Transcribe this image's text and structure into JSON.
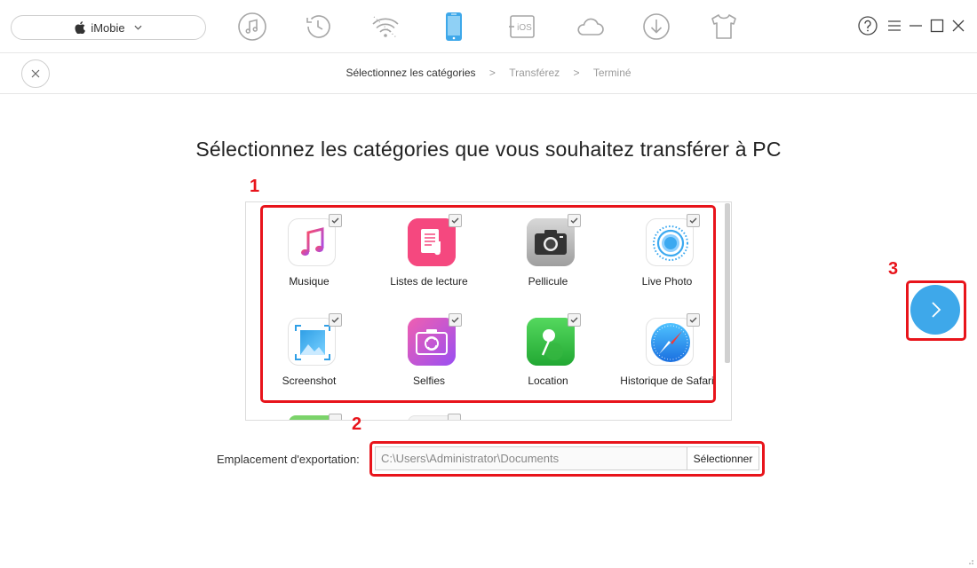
{
  "device_selector": {
    "label": "iMobie",
    "icon": "apple-icon"
  },
  "toolbar": {
    "tools": [
      {
        "name": "music-icon",
        "active": false
      },
      {
        "name": "history-icon",
        "active": false
      },
      {
        "name": "wifi-icon",
        "active": false
      },
      {
        "name": "phone-icon",
        "active": true
      },
      {
        "name": "ios-transfer-icon",
        "label": "iOS",
        "active": false
      },
      {
        "name": "cloud-icon",
        "active": false
      },
      {
        "name": "download-icon",
        "active": false
      },
      {
        "name": "tshirt-icon",
        "active": false
      }
    ],
    "accent": "#3ea8ea",
    "icon_color": "#a6a6a6"
  },
  "window_controls": [
    "help-icon",
    "menu-icon",
    "minimize-icon",
    "maximize-icon",
    "close-icon"
  ],
  "breadcrumb": {
    "steps": [
      "Sélectionnez les catégories",
      "Transférez",
      "Terminé"
    ],
    "separator": ">",
    "active_index": 0
  },
  "heading": "Sélectionnez les catégories que vous souhaitez transférer à PC",
  "categories": [
    {
      "label": "Musique",
      "icon": "music-note-icon",
      "checked": true
    },
    {
      "label": "Listes de lecture",
      "icon": "playlist-icon",
      "checked": true
    },
    {
      "label": "Pellicule",
      "icon": "camera-icon",
      "checked": true
    },
    {
      "label": "Live Photo",
      "icon": "live-photo-icon",
      "checked": true
    },
    {
      "label": "Screenshot",
      "icon": "screenshot-icon",
      "checked": true
    },
    {
      "label": "Selfies",
      "icon": "selfie-camera-icon",
      "checked": true
    },
    {
      "label": "Location",
      "icon": "location-pin-icon",
      "checked": true
    },
    {
      "label": "Historique de Safari",
      "icon": "safari-compass-icon",
      "checked": true
    }
  ],
  "export": {
    "label": "Emplacement d'exportation:",
    "path": "C:\\Users\\Administrator\\Documents",
    "button_label": "Sélectionner"
  },
  "next_button": {
    "icon": "chevron-right-icon"
  },
  "annotations": [
    "1",
    "2",
    "3"
  ],
  "annotation_color": "#e8141b"
}
